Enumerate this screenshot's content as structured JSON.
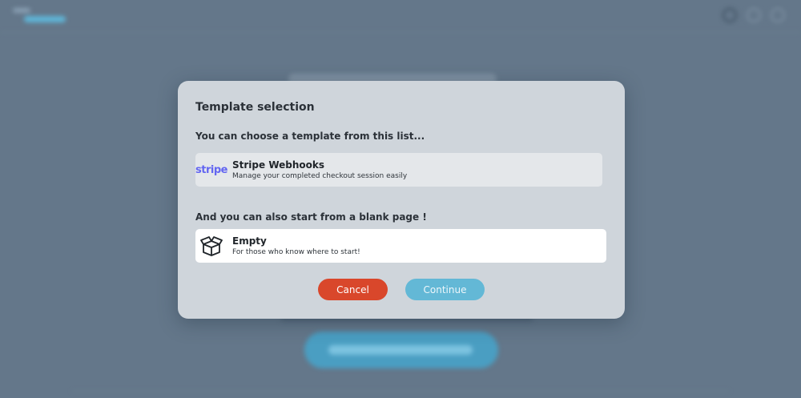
{
  "modal": {
    "title": "Template selection",
    "templates_label": "You can choose a template from this list...",
    "blank_label": "And you can also start from a blank page !",
    "templates": [
      {
        "icon": "stripe-logo",
        "logo_text": "stripe",
        "title": "Stripe Webhooks",
        "description": "Manage your completed checkout session easily"
      }
    ],
    "blank": {
      "icon": "open-box-icon",
      "title": "Empty",
      "description": "For those who know where to start!"
    },
    "cancel_label": "Cancel",
    "continue_label": "Continue"
  },
  "colors": {
    "overlay": "#64778a",
    "modal_bg": "#cfd5db",
    "cancel": "#d9472b",
    "continue": "#63b8d6",
    "stripe": "#6366f1"
  }
}
